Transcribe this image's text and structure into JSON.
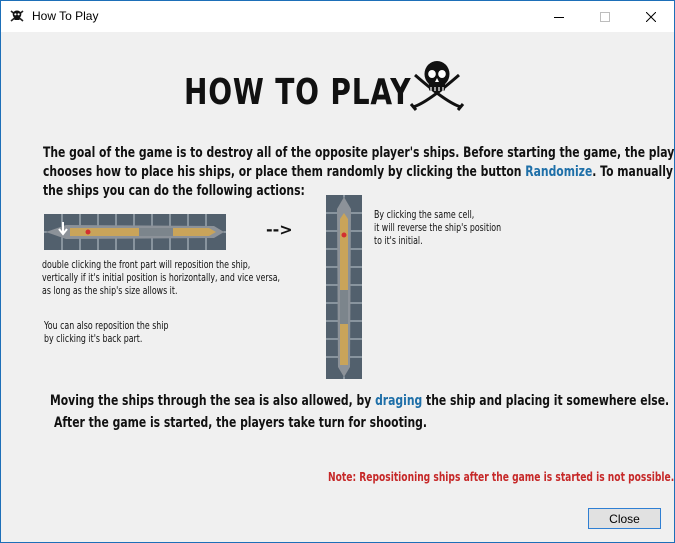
{
  "window": {
    "title": "How To Play",
    "icon": "pirate-skull-icon",
    "accent": "#1d6fb8"
  },
  "content": {
    "heading": "HOW TO PLAY",
    "intro": {
      "line1": "The goal of the game is to destroy all of the opposite player's ships. Before starting the game, the player",
      "line2_before": "chooses how to place his ships, or place them randomly by clicking the button ",
      "line2_link": "Randomize",
      "line2_after": ". To manually place",
      "line3": "the ships you can do the following actions:"
    },
    "arrow": "-->",
    "horizontal_caption": {
      "line1": "double clicking the front part will reposition the ship,",
      "line2": "vertically if  it's initial position is horizontally, and vice versa,",
      "line3": "as long as the ship's size allows it."
    },
    "back_part_caption": {
      "line1": "You can also reposition the ship",
      "line2": "by clicking it's back part."
    },
    "vertical_caption": {
      "line1": "By clicking the same cell,",
      "line2": "it will reverse the ship's position",
      "line3": "to it's initial."
    },
    "moving": {
      "before": "Moving the ships through the sea is also allowed, by ",
      "link": "draging",
      "after": " the ship and placing it somewhere else."
    },
    "turns": "After the game is started, the players take turn for shooting.",
    "note": "Note: Repositioning ships after the game is started is not possible.",
    "note_color": "#c62828",
    "link_color": "#1e6fa8"
  },
  "buttons": {
    "close": "Close"
  }
}
